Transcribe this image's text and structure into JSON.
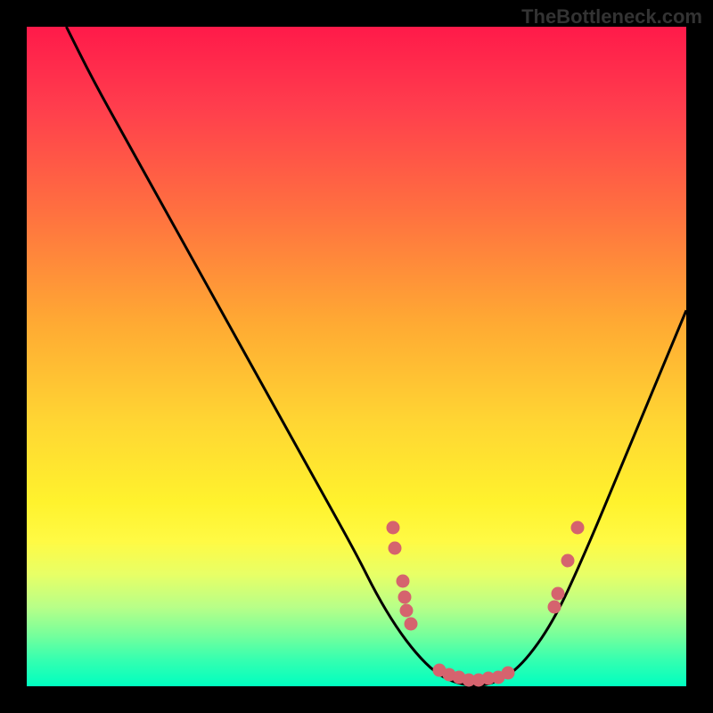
{
  "watermark": "TheBottleneck.com",
  "chart_data": {
    "type": "line",
    "title": "",
    "xlabel": "",
    "ylabel": "",
    "xlim": [
      0,
      100
    ],
    "ylim": [
      0,
      100
    ],
    "series": [
      {
        "name": "curve",
        "x": [
          6,
          10,
          15,
          20,
          25,
          30,
          35,
          40,
          45,
          50,
          53,
          56,
          59,
          62,
          65,
          68,
          71,
          75,
          80,
          85,
          90,
          95,
          100
        ],
        "y": [
          100,
          92,
          83,
          74,
          65,
          56,
          47,
          38,
          29,
          20,
          14,
          9,
          5,
          2,
          0.5,
          0,
          0.5,
          3,
          10,
          21,
          33,
          45,
          57
        ]
      }
    ],
    "points": [
      {
        "x": 55.5,
        "y": 24
      },
      {
        "x": 55.8,
        "y": 21
      },
      {
        "x": 57,
        "y": 16
      },
      {
        "x": 57.3,
        "y": 13.5
      },
      {
        "x": 57.6,
        "y": 11.5
      },
      {
        "x": 58.2,
        "y": 9.5
      },
      {
        "x": 62.5,
        "y": 2.5
      },
      {
        "x": 64,
        "y": 1.8
      },
      {
        "x": 65.5,
        "y": 1.3
      },
      {
        "x": 67,
        "y": 1.0
      },
      {
        "x": 68.5,
        "y": 1.0
      },
      {
        "x": 70,
        "y": 1.2
      },
      {
        "x": 71.5,
        "y": 1.3
      },
      {
        "x": 73,
        "y": 2.0
      },
      {
        "x": 80,
        "y": 12
      },
      {
        "x": 80.5,
        "y": 14
      },
      {
        "x": 82,
        "y": 19
      },
      {
        "x": 83.5,
        "y": 24
      }
    ],
    "background_gradient": {
      "top": "#ff1a4a",
      "mid": "#ffd633",
      "bottom": "#00ffc0"
    },
    "point_color": "#d5636e"
  }
}
